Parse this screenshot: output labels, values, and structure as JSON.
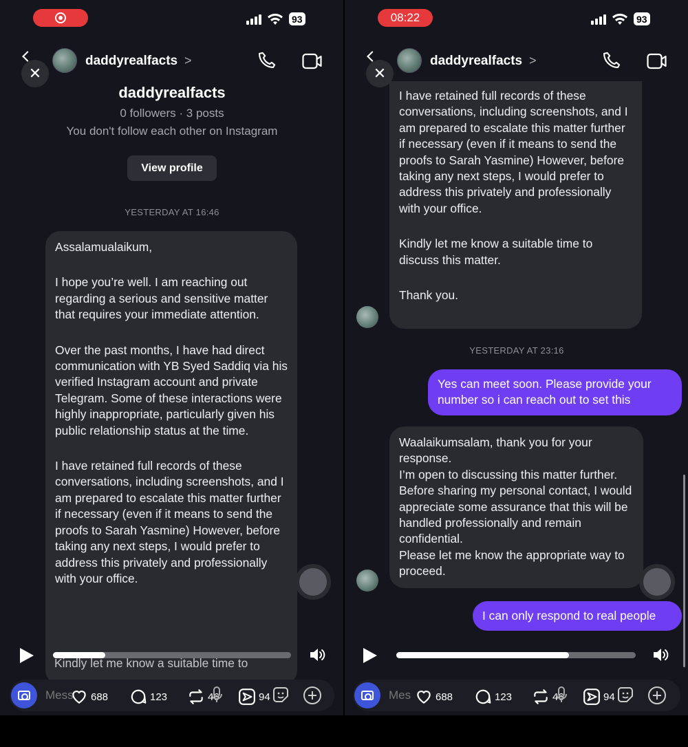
{
  "left": {
    "status": {
      "battery": "93"
    },
    "header": {
      "username": "daddyrealfacts",
      "chevron": ">"
    },
    "profile": {
      "name": "daddyrealfacts",
      "stats": "0 followers · 3 posts",
      "follow_note": "You don't follow each other on Instagram",
      "view_profile_label": "View profile"
    },
    "timestamp": "YESTERDAY AT 16:46",
    "message": {
      "p1": "Assalamualaikum,",
      "p2": "I hope you’re well. I am reaching out regarding a serious and sensitive matter that requires your immediate attention.",
      "p3": "Over the past months, I have had direct communication with YB Syed Saddiq via his verified Instagram account and private Telegram. Some of these interactions were highly inappropriate, particularly given his public relationship status at the time.",
      "p4": "I have retained full records of these conversations, including screenshots, and I am prepared to escalate this matter further if necessary (even if it means to send the proofs to Sarah Yasmine) However, before taking any next steps, I would prefer to address this privately and professionally with your office."
    },
    "under_text": "Kindly let me know a suitable time to",
    "progress_fraction": 0.22,
    "composer_placeholder": "Mess",
    "stats": {
      "likes": "688",
      "comments": "123",
      "reposts": "46",
      "shares": "94"
    }
  },
  "right": {
    "status": {
      "time": "08:22",
      "battery": "93"
    },
    "header": {
      "username": "daddyrealfacts",
      "chevron": ">"
    },
    "message1": {
      "p1": "I have retained full records of these conversations, including screenshots, and I am prepared to escalate this matter further if necessary (even if it means to send the proofs to Sarah Yasmine) However, before taking any next steps, I would prefer to address this privately and professionally with your office.",
      "p2": "Kindly let me know a suitable time to discuss this matter.",
      "p3": "Thank you."
    },
    "timestamp": "YESTERDAY AT 23:16",
    "sent1": "Yes can meet soon. Please provide your number so i can reach out to set this",
    "message2": "Waalaikumsalam, thank you for your response.\nI’m open to discussing this matter further. Before sharing my personal contact, I would appreciate some assurance that this will be handled professionally and remain confidential.\nPlease let me know the appropriate way to proceed.",
    "sent2": "I can only respond to real people",
    "progress_fraction": 0.72,
    "composer_placeholder": "Mes",
    "stats": {
      "likes": "688",
      "comments": "123",
      "reposts": "46",
      "shares": "94"
    }
  },
  "colors": {
    "outgoing_bubble": "#6f3df2",
    "incoming_bubble": "#2a2b31",
    "record_pill": "#e5393b",
    "camera_button": "#3f55d9"
  },
  "icons": [
    "back-icon",
    "close-icon",
    "phone-icon",
    "video-call-icon",
    "play-icon",
    "volume-icon",
    "camera-icon",
    "heart-icon",
    "comment-icon",
    "repost-icon",
    "mic-icon",
    "share-icon",
    "sticker-icon",
    "plus-icon"
  ]
}
